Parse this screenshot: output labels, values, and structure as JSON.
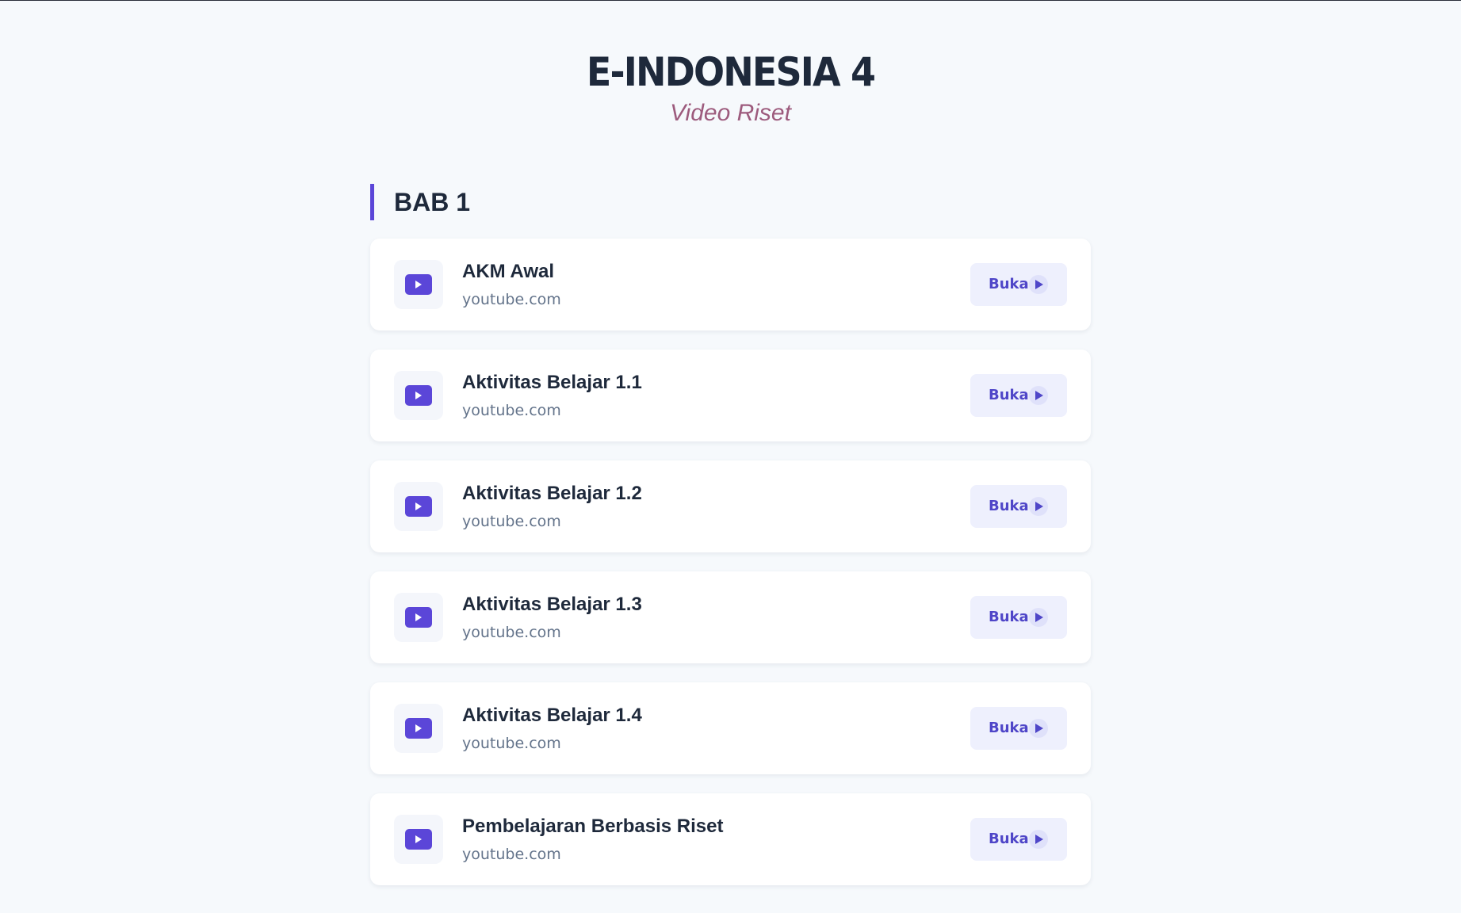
{
  "header": {
    "title": "E-INDONESIA 4",
    "subtitle": "Video Riset"
  },
  "section": {
    "heading": "BAB 1",
    "items": [
      {
        "title": "AKM Awal",
        "source": "youtube.com",
        "button_label": "Buka",
        "icon": "youtube-play-icon"
      },
      {
        "title": "Aktivitas Belajar 1.1",
        "source": "youtube.com",
        "button_label": "Buka",
        "icon": "youtube-play-icon"
      },
      {
        "title": "Aktivitas Belajar 1.2",
        "source": "youtube.com",
        "button_label": "Buka",
        "icon": "youtube-play-icon"
      },
      {
        "title": "Aktivitas Belajar 1.3",
        "source": "youtube.com",
        "button_label": "Buka",
        "icon": "youtube-play-icon"
      },
      {
        "title": "Aktivitas Belajar 1.4",
        "source": "youtube.com",
        "button_label": "Buka",
        "icon": "youtube-play-icon"
      },
      {
        "title": "Pembelajaran Berbasis Riset",
        "source": "youtube.com",
        "button_label": "Buka",
        "icon": "youtube-play-icon"
      }
    ]
  },
  "colors": {
    "accent": "#5b46d8",
    "page_background": "#f6f9fc",
    "subtitle": "#9d5b7d",
    "button_background": "#eef0fd",
    "button_text": "#4f46c8"
  }
}
